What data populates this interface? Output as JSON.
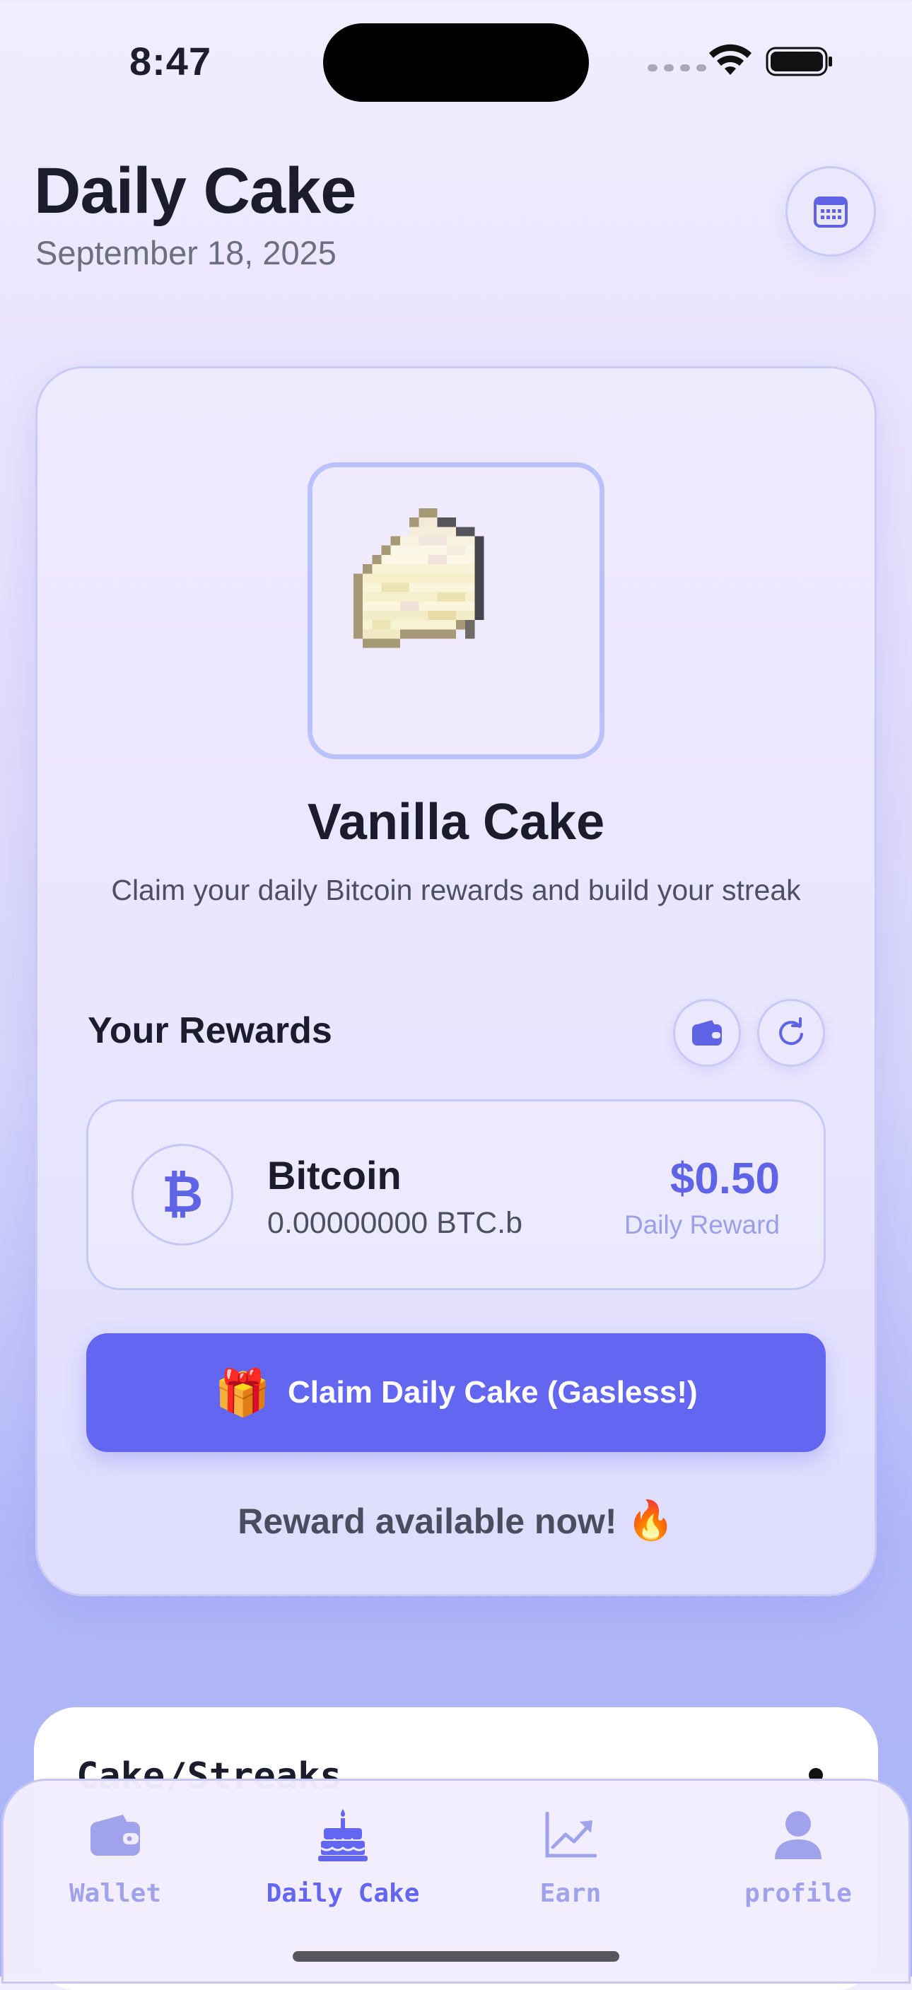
{
  "status_bar": {
    "time": "8:47"
  },
  "header": {
    "title": "Daily Cake",
    "date": "September 18, 2025",
    "calendar_icon": "calendar-icon"
  },
  "cake": {
    "name": "Vanilla Cake",
    "description": "Claim your daily Bitcoin rewards and build your streak"
  },
  "rewards": {
    "title": "Your Rewards",
    "token": {
      "symbol": "₿",
      "name": "Bitcoin",
      "balance": "0.00000000 BTC.b",
      "value": "$0.50",
      "value_label": "Daily Reward"
    }
  },
  "claim_button": {
    "emoji": "🎁",
    "label": "Claim Daily Cake (Gasless!)"
  },
  "availability": {
    "text": "Reward available now!",
    "emoji": "🔥"
  },
  "streaks_card": {
    "title": "Cake/Streaks"
  },
  "tabs": [
    {
      "label": "Wallet",
      "icon": "wallet-icon",
      "active": false
    },
    {
      "label": "Daily Cake",
      "icon": "birthday-cake-icon",
      "active": true
    },
    {
      "label": "Earn",
      "icon": "chart-icon",
      "active": false
    },
    {
      "label": "profile",
      "icon": "user-icon",
      "active": false
    }
  ],
  "colors": {
    "accent": "#6366f1",
    "accent_light": "#a0a3ec",
    "card_bg": "#efeafd"
  }
}
